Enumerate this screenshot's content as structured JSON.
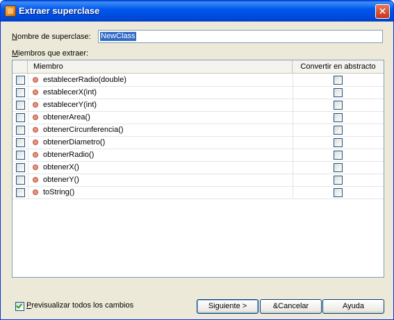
{
  "window": {
    "title": "Extraer superclase",
    "close_glyph": "✕"
  },
  "form": {
    "name_label_prefix": "N",
    "name_label_rest": "ombre de superclase:",
    "name_value": "NewClass",
    "members_label_prefix": "M",
    "members_label_rest": "iembros que extraer:"
  },
  "table": {
    "columns": [
      "",
      "Miembro",
      "Convertir en abstracto"
    ],
    "rows": [
      {
        "name": "establecerRadio(double)",
        "selected": false,
        "abstract": false
      },
      {
        "name": "establecerX(int)",
        "selected": false,
        "abstract": false
      },
      {
        "name": "establecerY(int)",
        "selected": false,
        "abstract": false
      },
      {
        "name": "obtenerArea()",
        "selected": false,
        "abstract": false
      },
      {
        "name": "obtenerCircunferencia()",
        "selected": false,
        "abstract": false
      },
      {
        "name": "obtenerDiametro()",
        "selected": false,
        "abstract": false
      },
      {
        "name": "obtenerRadio()",
        "selected": false,
        "abstract": false
      },
      {
        "name": "obtenerX()",
        "selected": false,
        "abstract": false
      },
      {
        "name": "obtenerY()",
        "selected": false,
        "abstract": false
      },
      {
        "name": "toString()",
        "selected": false,
        "abstract": false
      }
    ]
  },
  "footer": {
    "preview_label_prefix": "P",
    "preview_label_rest": "revisualizar todos los cambios",
    "preview_checked": true,
    "next_label": "Siguiente >",
    "cancel_label": "&Cancelar",
    "help_label": "Ayuda"
  },
  "colors": {
    "titlebar": "#0058ee",
    "selection": "#316ac5",
    "method_icon": "#e8937d",
    "dialog_bg": "#ece9d8"
  }
}
